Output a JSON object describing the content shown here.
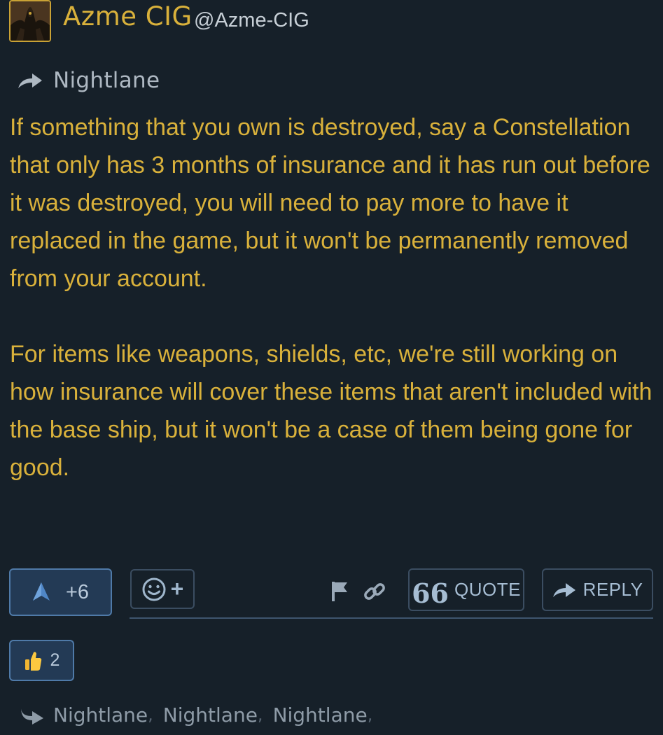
{
  "author": {
    "name": "Azme CIG",
    "handle": "@Azme-CIG",
    "avatar_icon": "character-avatar"
  },
  "in_reply_to": {
    "icon": "reply-arrow-icon",
    "name": "Nightlane"
  },
  "post": {
    "paragraphs": [
      "If something that you own is destroyed, say a Constellation that only has 3 months of insurance and it has run out before it was destroyed, you will need to pay more to have it replaced in the game, but it won't be permanently removed from your account.",
      "For items like weapons, shields, etc, we're still working on how insurance will cover these items that aren't included with the base ship, but it won't be a case of them being gone for good."
    ]
  },
  "actions": {
    "vote_count": "+6",
    "react_plus": "+",
    "quote_label": "QUOTE",
    "quote_mark": "66",
    "reply_label": "REPLY"
  },
  "reaction": {
    "icon": "thumbs-up-icon",
    "count": "2"
  },
  "replies": {
    "icon": "replies-arrow-icon",
    "names": [
      "Nightlane",
      "Nightlane",
      "Nightlane"
    ],
    "separator": ","
  },
  "colors": {
    "background": "#162029",
    "accent_gold": "#d9b13b",
    "button_blue": "#233a55",
    "button_border": "#4f7aa8"
  }
}
